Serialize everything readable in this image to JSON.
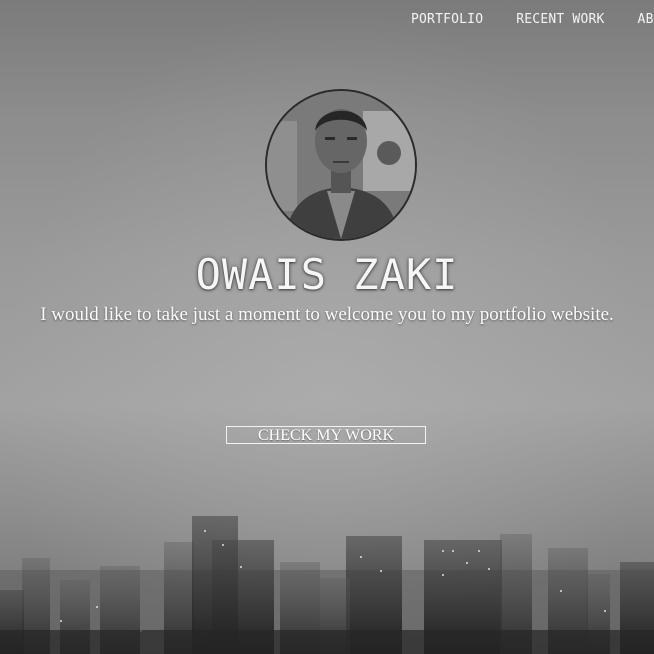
{
  "nav": {
    "items": [
      {
        "label": "PORTFOLIO"
      },
      {
        "label": "RECENT WORK"
      },
      {
        "label": "ABOUT"
      }
    ]
  },
  "hero": {
    "name": "OWAIS ZAKI",
    "tagline": "I would like to take just a moment to welcome you to my portfolio website.",
    "cta_label": "CHECK MY WORK"
  },
  "colors": {
    "text": "#f6f6f6",
    "sky": "#9a9a9a"
  }
}
